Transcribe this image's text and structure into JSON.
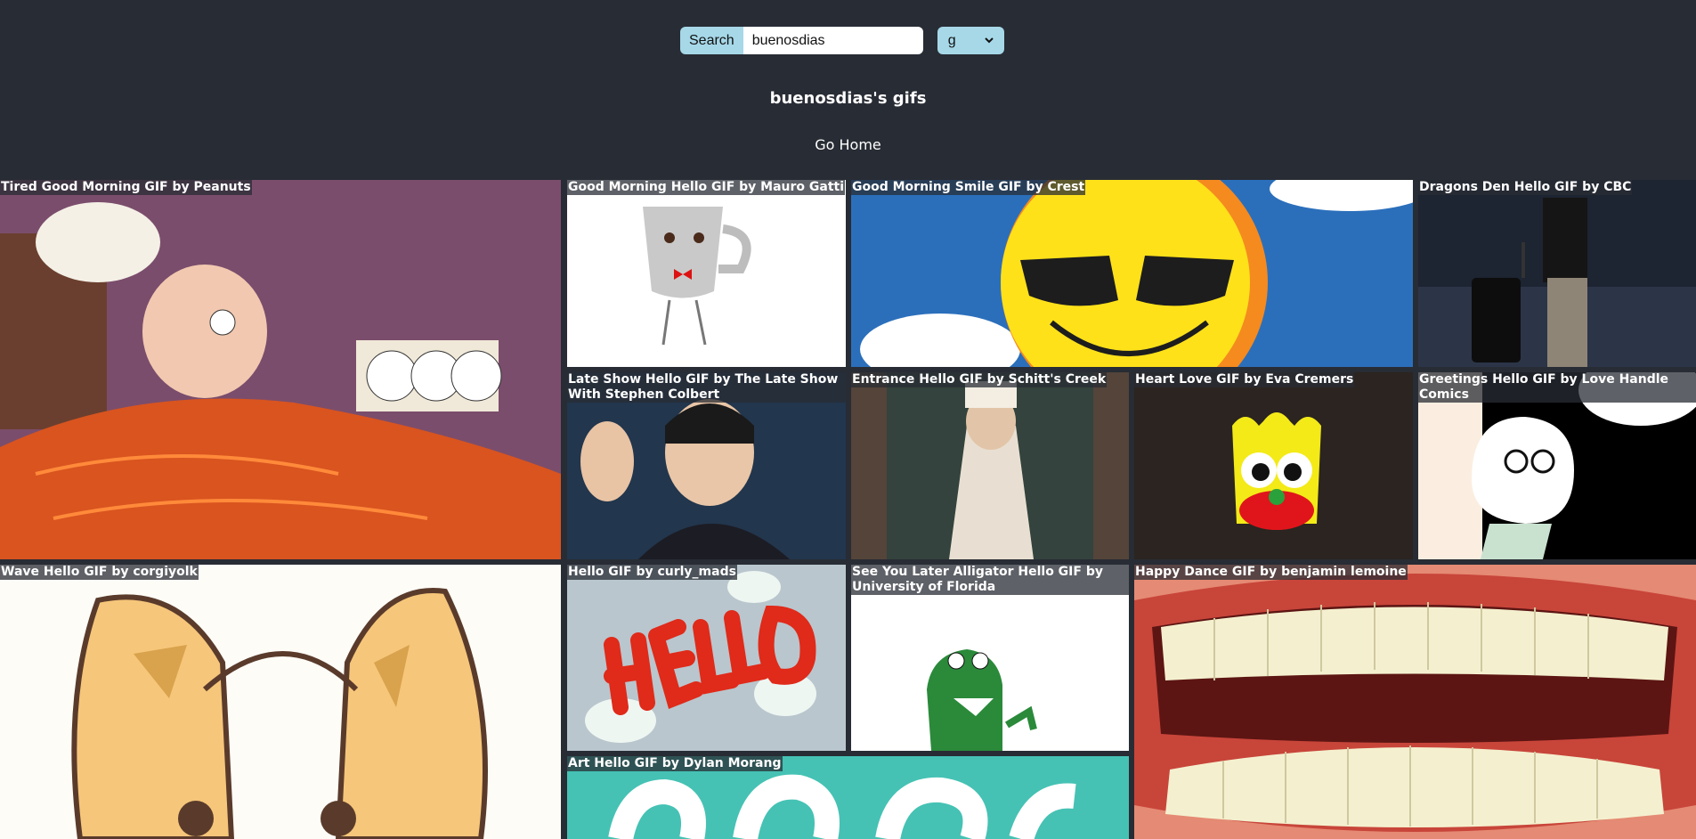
{
  "search": {
    "button_label": "Search",
    "query": "buenosdias",
    "rating_selected": "g"
  },
  "page_title": "buenosdias's gifs",
  "nav": {
    "home_label": "Go Home"
  },
  "gifs": [
    {
      "title": "Tired Good Morning GIF by Peanuts"
    },
    {
      "title": "Good Morning Hello GIF by Mauro Gatti"
    },
    {
      "title": "Good Morning Smile GIF by Crest"
    },
    {
      "title": "Dragons Den Hello GIF by CBC"
    },
    {
      "title": "Late Show Hello GIF by The Late Show With Stephen Colbert"
    },
    {
      "title": "Entrance Hello GIF by Schitt's Creek"
    },
    {
      "title": "Heart Love GIF by Eva Cremers"
    },
    {
      "title": "Greetings Hello GIF by Love Handle Comics"
    },
    {
      "title": "Wave Hello GIF by corgiyolk"
    },
    {
      "title": "Hello GIF by curly_mads"
    },
    {
      "title": "See You Later Alligator Hello GIF by University of Florida"
    },
    {
      "title": "Happy Dance GIF by benjamin lemoine"
    },
    {
      "title": "Art Hello GIF by Dylan Morang"
    }
  ],
  "colors": {
    "background": "#282c34",
    "accent": "#a6d8e8"
  }
}
